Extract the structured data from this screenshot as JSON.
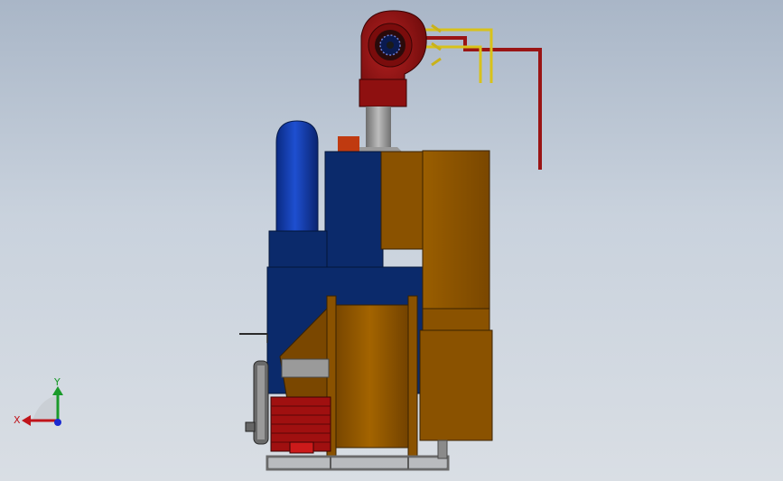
{
  "scene": {
    "colors": {
      "background_top": "#a9b6c7",
      "background_bottom": "#d9dee4",
      "blower_red": "#8e1010",
      "body_blue": "#0b2a6b",
      "tank_blue": "#0c2f8a",
      "hopper_orange": "#8a5200",
      "pipe_yellow": "#d8c21a",
      "pipe_red": "#9a1414",
      "frame_gray": "#8a8a8a"
    }
  },
  "triad": {
    "x_label": "X",
    "y_label": "Y",
    "x_color": "#c0141a",
    "y_color": "#1a9a2a",
    "z_color": "#1a2ad0"
  }
}
